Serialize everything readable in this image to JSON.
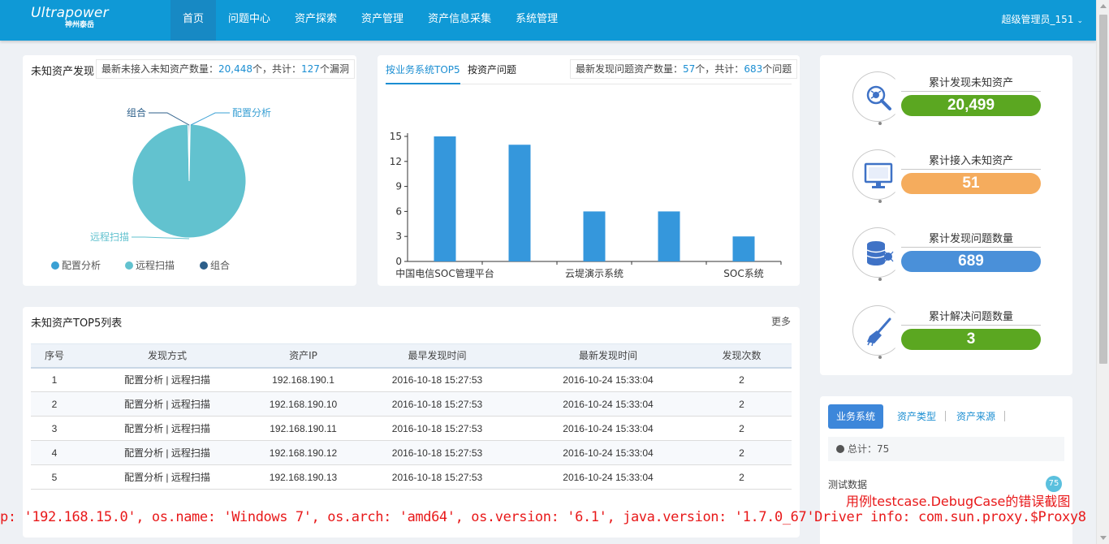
{
  "header": {
    "logo_line1": "Ultrapower",
    "logo_line2": "神州泰岳",
    "nav": [
      "首页",
      "问题中心",
      "资产探索",
      "资产管理",
      "资产信息采集",
      "系统管理"
    ],
    "user": "超级管理员_151"
  },
  "unknown_discovery": {
    "title": "未知资产发现",
    "info_prefix": "最新未接入未知资产数量：",
    "info_num1": "20,448",
    "info_mid": "个，共计：",
    "info_num2": "127",
    "info_suffix": "个漏洞",
    "pie_label_combo": "组合",
    "pie_label_config": "配置分析",
    "pie_label_scan": "远程扫描",
    "legend": [
      "配置分析",
      "远程扫描",
      "组合"
    ]
  },
  "business_top5": {
    "tab_active": "按业务系统TOP5",
    "tab_other": "按资产问题",
    "info_prefix": "最新发现问题资产数量：",
    "info_num1": "57",
    "info_mid": "个，共计：",
    "info_num2": "683",
    "info_suffix": "个问题"
  },
  "chart_data": [
    {
      "type": "pie",
      "categories": [
        "配置分析",
        "远程扫描",
        "组合"
      ],
      "values": [
        0.3,
        99.4,
        0.3
      ],
      "colors": [
        "#3aa0d4",
        "#62c2cf",
        "#2c5f8a"
      ],
      "legend_position": "bottom"
    },
    {
      "type": "bar",
      "categories": [
        "中国电信SOC管理平台",
        "",
        "云堤演示系统",
        "",
        "SOC系统"
      ],
      "values": [
        15,
        14,
        6,
        6,
        3
      ],
      "ylim": [
        0,
        15
      ],
      "yticks": [
        0,
        3,
        6,
        9,
        12,
        15
      ],
      "color": "#3597dc",
      "grid": false
    }
  ],
  "top5_list": {
    "title": "未知资产TOP5列表",
    "more": "更多",
    "headers": [
      "序号",
      "发现方式",
      "资产IP",
      "最早发现时间",
      "最新发现时间",
      "发现次数"
    ],
    "rows": [
      [
        "1",
        "配置分析 | 远程扫描",
        "192.168.190.1",
        "2016-10-18 15:27:53",
        "2016-10-24 15:33:04",
        "2"
      ],
      [
        "2",
        "配置分析 | 远程扫描",
        "192.168.190.10",
        "2016-10-18 15:27:53",
        "2016-10-24 15:33:04",
        "2"
      ],
      [
        "3",
        "配置分析 | 远程扫描",
        "192.168.190.11",
        "2016-10-18 15:27:53",
        "2016-10-24 15:33:04",
        "2"
      ],
      [
        "4",
        "配置分析 | 远程扫描",
        "192.168.190.12",
        "2016-10-18 15:27:53",
        "2016-10-24 15:33:04",
        "2"
      ],
      [
        "5",
        "配置分析 | 远程扫描",
        "192.168.190.13",
        "2016-10-18 15:27:53",
        "2016-10-24 15:33:04",
        "2"
      ]
    ]
  },
  "stats": [
    {
      "label": "累计发现未知资产",
      "value": "20,499",
      "color": "#5ba721",
      "icon": "magnify-bug-icon"
    },
    {
      "label": "累计接入未知资产",
      "value": "51",
      "color": "#f5ac5d",
      "icon": "monitor-icon"
    },
    {
      "label": "累计发现问题数量",
      "value": "689",
      "color": "#4a90d9",
      "icon": "database-bug-icon"
    },
    {
      "label": "累计解决问题数量",
      "value": "3",
      "color": "#5ba721",
      "icon": "broom-icon"
    }
  ],
  "bottom_right": {
    "tabs": [
      "业务系统",
      "资产类型",
      "资产来源"
    ],
    "total": "总计：75",
    "item_label": "测试数据",
    "item_badge": "75"
  },
  "error_overlay": {
    "title": "用例testcase.DebugCase的错误截图",
    "line": "p: '192.168.15.0', os.name: 'Windows 7', os.arch: 'amd64', os.version: '6.1', java.version: '1.7.0_67'Driver info: com.sun.proxy.$Proxy8"
  }
}
